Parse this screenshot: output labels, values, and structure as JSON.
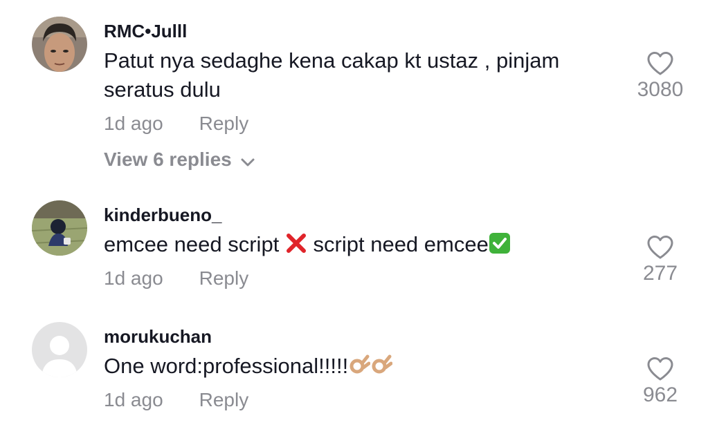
{
  "comments": [
    {
      "username": "RMC•Julll",
      "text": "Patut nya sedaghe kena cakap kt ustaz , pinjam seratus dulu",
      "time": "1d ago",
      "reply_label": "Reply",
      "likes": "3080",
      "view_replies": "View 6 replies",
      "avatar_icon": "person-photo-avatar"
    },
    {
      "username": "kinderbueno_",
      "text_part1": "emcee need script ",
      "text_part2": " script need emcee",
      "time": "1d ago",
      "reply_label": "Reply",
      "likes": "277",
      "avatar_icon": "anime-character-avatar",
      "emoji_1": "red-cross-mark",
      "emoji_2": "green-check-mark"
    },
    {
      "username": "morukuchan",
      "text": "One word:professional!!!!!",
      "time": "1d ago",
      "reply_label": "Reply",
      "likes": "962",
      "avatar_icon": "default-user-avatar",
      "emoji": "ok-hand"
    }
  ],
  "colors": {
    "primary_text": "#161823",
    "secondary_text": "#8a8b91",
    "heart_stroke": "#8a8b91"
  }
}
